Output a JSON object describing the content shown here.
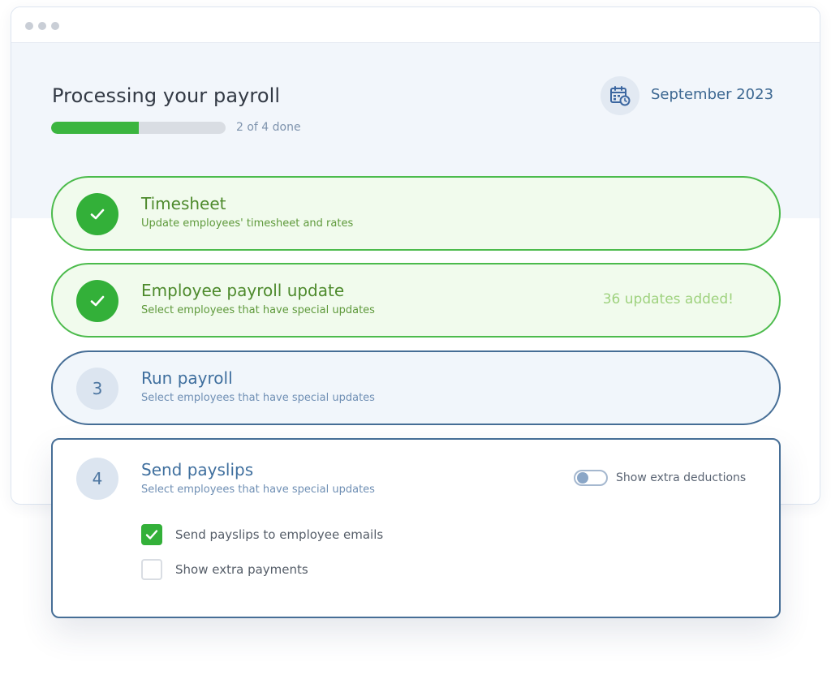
{
  "page": {
    "title": "Processing your payroll",
    "progress_text": "2 of 4 done",
    "progress_value": 0.5,
    "date_label": "September 2023"
  },
  "steps": [
    {
      "title": "Timesheet",
      "subtitle": "Update employees' timesheet and rates",
      "status": "done"
    },
    {
      "title": "Employee payroll update",
      "subtitle": "Select employees that have special updates",
      "status": "done",
      "note": "36 updates added!"
    },
    {
      "title": "Run payroll",
      "subtitle": "Select employees that have special updates",
      "status": "active",
      "number": "3"
    },
    {
      "title": "Send payslips",
      "subtitle": "Select employees that have special updates",
      "status": "open",
      "number": "4",
      "toggle_label": "Show extra deductions",
      "toggle_on": false,
      "options": [
        {
          "label": "Send payslips to employee emails",
          "checked": true
        },
        {
          "label": "Show extra payments",
          "checked": false
        }
      ]
    }
  ],
  "colors": {
    "accent_green": "#33b039",
    "accent_blue": "#466e96",
    "hero_bg": "#f2f6fb"
  },
  "icons": {
    "window_dots": "window-control-dot",
    "date": "calendar-clock-icon",
    "done": "checkmark-icon"
  }
}
